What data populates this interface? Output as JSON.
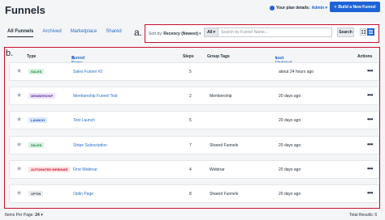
{
  "header": {
    "title": "Funnels",
    "plan_label": "Your plan details:",
    "plan_value": "Admin",
    "build_button": "Build a New Funnel"
  },
  "tabs": [
    {
      "label": "All Funnels",
      "active": true
    },
    {
      "label": "Archived",
      "active": false
    },
    {
      "label": "Marketplace",
      "active": false
    },
    {
      "label": "Shared",
      "active": false
    }
  ],
  "annotations": {
    "a": "a.",
    "b": "b."
  },
  "filters": {
    "sort_label": "Sort by:",
    "sort_value": "Recency (Newest)",
    "scope_value": "All",
    "search_placeholder": "Search by Funnel Name...",
    "search_button": "Search"
  },
  "table": {
    "columns": {
      "type": "Type",
      "funnel_name": "Funnel Name",
      "steps": "Steps",
      "group_tags": "Group Tags",
      "last_updated": "Last Updated",
      "actions": "Actions"
    },
    "rows": [
      {
        "type": "SALES",
        "type_style": "green",
        "name": "Sales Funnel #2",
        "steps": "5",
        "tags": "",
        "updated": "about 24 hours ago",
        "actions": "•••"
      },
      {
        "type": "MEMBERSHIP",
        "type_style": "purple",
        "name": "Membership Funnel Test",
        "steps": "2",
        "tags": "Membership",
        "updated": "20 days ago",
        "actions": "•••"
      },
      {
        "type": "LAUNCH",
        "type_style": "blue",
        "name": "Test Launch",
        "steps": "5",
        "tags": "",
        "updated": "20 days ago",
        "actions": "•••"
      },
      {
        "type": "SALES",
        "type_style": "green",
        "name": "Stripe Subscription",
        "steps": "7",
        "tags": "Shared Funnels",
        "updated": "20 days ago",
        "actions": "•••"
      },
      {
        "type": "AUTOMATED WEBINAR",
        "type_style": "red",
        "name": "First Webinar",
        "steps": "4",
        "tags": "Webinar",
        "updated": "20 days ago",
        "actions": "•••"
      },
      {
        "type": "OPTIN",
        "type_style": "gray",
        "name": "Optin Page",
        "steps": "8",
        "tags": "Shared Funnels",
        "updated": "20 days ago",
        "actions": "•••"
      }
    ]
  },
  "footer": {
    "per_page_label": "Items Per Page:",
    "per_page_value": "24",
    "total_label": "Total Results: 6"
  },
  "colors": {
    "accent": "#1e63d6",
    "annotation_border": "#c8102e",
    "link": "#2b6cc4"
  }
}
